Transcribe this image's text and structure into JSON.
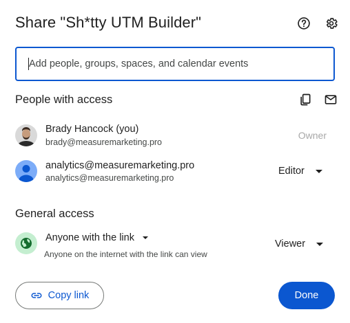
{
  "dialog": {
    "title": "Share \"Sh*tty UTM Builder\"",
    "help_icon": "help-circle-icon",
    "settings_icon": "gear-icon"
  },
  "add_people": {
    "placeholder": "Add people, groups, spaces, and calendar events",
    "value": ""
  },
  "people_section": {
    "title": "People with access",
    "copy_icon": "copy-emails-icon",
    "email_icon": "mail-icon",
    "people": [
      {
        "name": "Brady Hancock (you)",
        "email": "brady@measuremarketing.pro",
        "role": "Owner"
      },
      {
        "name": "analytics@measuremarketing.pro",
        "email": "analytics@measuremarketing.pro",
        "role": "Editor"
      }
    ]
  },
  "general_access": {
    "title": "General access",
    "access_level": "Anyone with the link",
    "description": "Anyone on the internet with the link can view",
    "role": "Viewer",
    "icon": "globe-icon"
  },
  "footer": {
    "copy_link_label": "Copy link",
    "done_label": "Done"
  },
  "colors": {
    "accent": "#0b57d0",
    "globe_bg": "#c4eed0",
    "globe_fg": "#146c2e",
    "avatar_blue": "#7cacf8"
  }
}
